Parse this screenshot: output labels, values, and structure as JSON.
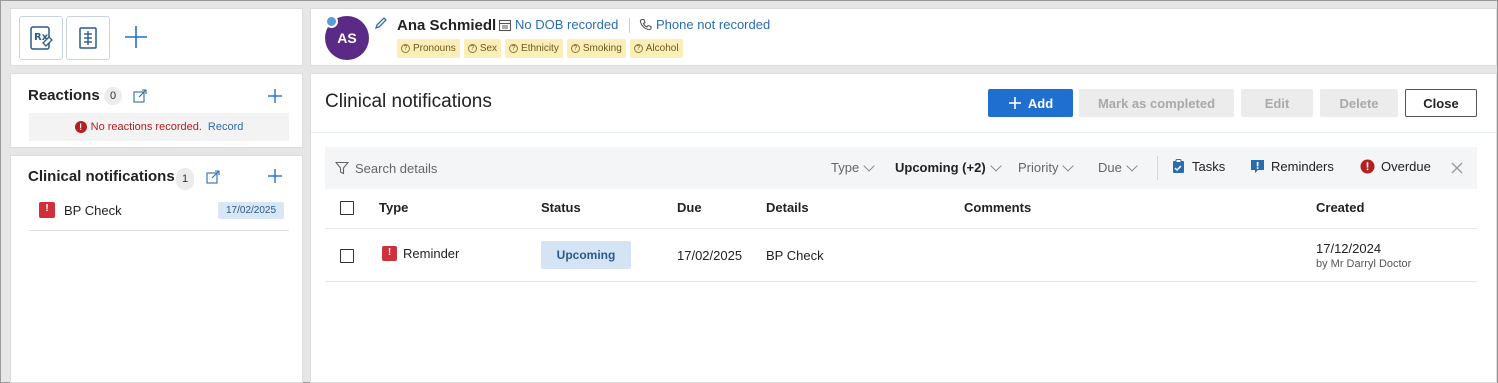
{
  "toolbar": {
    "icons": [
      "prescription-icon",
      "document-icon",
      "plus-icon"
    ]
  },
  "patient": {
    "initials": "AS",
    "name": "Ana Schmiedl",
    "dob": "No DOB recorded",
    "phone": "Phone not recorded",
    "tags": [
      "Pronouns",
      "Sex",
      "Ethnicity",
      "Smoking",
      "Alcohol"
    ],
    "avatar_color": "#5b2a86"
  },
  "reactions": {
    "title": "Reactions",
    "count": "0",
    "empty_message": "No reactions recorded.",
    "record_link": "Record"
  },
  "side_notifications": {
    "title": "Clinical notifications",
    "count": "1",
    "items": [
      {
        "label": "BP Check",
        "date": "17/02/2025"
      }
    ]
  },
  "main": {
    "title": "Clinical notifications",
    "buttons": {
      "add": "Add",
      "mark_completed": "Mark as completed",
      "edit": "Edit",
      "delete": "Delete",
      "close": "Close"
    },
    "filters": {
      "search_placeholder": "Search details",
      "type": "Type",
      "upcoming": "Upcoming (+2)",
      "priority": "Priority",
      "due": "Due",
      "tasks": "Tasks",
      "reminders": "Reminders",
      "overdue": "Overdue"
    },
    "columns": {
      "type": "Type",
      "status": "Status",
      "due": "Due",
      "details": "Details",
      "comments": "Comments",
      "created": "Created"
    },
    "rows": [
      {
        "type": "Reminder",
        "status": "Upcoming",
        "due": "17/02/2025",
        "details": "BP Check",
        "comments": "",
        "created": "17/12/2024",
        "created_by": "by Mr Darryl Doctor"
      }
    ]
  },
  "colors": {
    "primary": "#1f6fd1",
    "link": "#2b6cb0",
    "alert": "#d0303a",
    "tag_bg": "#fbeeb8"
  }
}
